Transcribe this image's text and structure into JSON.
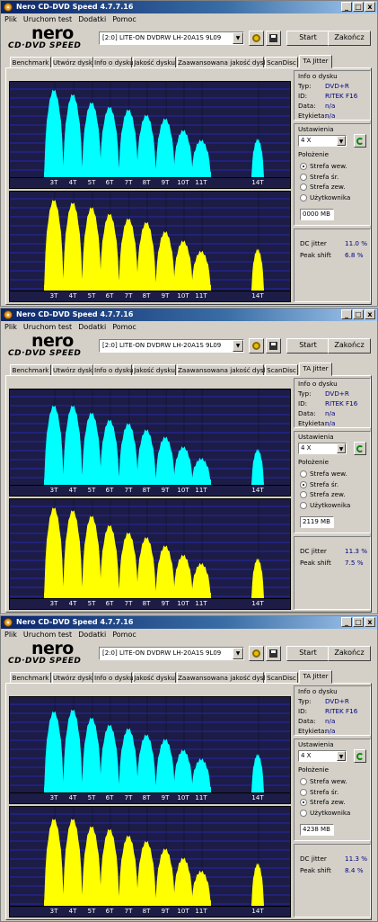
{
  "windows": [
    {
      "title": "Nero CD-DVD Speed 4.7.7.16",
      "title_buttons": [
        "_",
        "□",
        "x"
      ],
      "menu": [
        "Plik",
        "Uruchom test",
        "Dodatki",
        "Pomoc"
      ],
      "logo": {
        "brand": "nero",
        "sub": "CD·DVD SPEED"
      },
      "drive": "[2:0]   LITE-ON DVDRW LH-20A1S 9L09",
      "buttons": {
        "start": "Start",
        "close": "Zakończ"
      },
      "tabs": [
        "Benchmark",
        "Utwórz dysk",
        "Info o dysku",
        "Jakość dysku",
        "Zaawansowana jakość dysku",
        "ScanDisc",
        "TA Jitter"
      ],
      "active_tab": "TA Jitter",
      "x_ticks": [
        "3T",
        "4T",
        "5T",
        "6T",
        "7T",
        "8T",
        "9T",
        "10T",
        "11T",
        "14T"
      ],
      "disc_info": {
        "title": "Info o dysku",
        "rows": [
          {
            "label": "Typ:",
            "value": "DVD+R"
          },
          {
            "label": "ID:",
            "value": "RITEK F16"
          },
          {
            "label": "Data:",
            "value": "n/a"
          },
          {
            "label": "Etykieta:",
            "value": "n/a"
          }
        ]
      },
      "settings": {
        "title": "Ustawienia",
        "speed": "4 X"
      },
      "position": {
        "title": "Położenie",
        "options": [
          "Strefa wew.",
          "Strefa śr.",
          "Strefa zew.",
          "Użytkownika"
        ],
        "selected": 0,
        "mb": "0000 MB"
      },
      "stats": [
        {
          "label": "DC jitter",
          "value": "11.0 %"
        },
        {
          "label": "Peak shift",
          "value": "6.8 %"
        }
      ]
    },
    {
      "title": "Nero CD-DVD Speed 4.7.7.16",
      "title_buttons": [
        "_",
        "□",
        "x"
      ],
      "menu": [
        "Plik",
        "Uruchom test",
        "Dodatki",
        "Pomoc"
      ],
      "logo": {
        "brand": "nero",
        "sub": "CD·DVD SPEED"
      },
      "drive": "[2:0]   LITE-ON DVDRW LH-20A1S 9L09",
      "buttons": {
        "start": "Start",
        "close": "Zakończ"
      },
      "tabs": [
        "Benchmark",
        "Utwórz dysk",
        "Info o dysku",
        "Jakość dysku",
        "Zaawansowana jakość dysku",
        "ScanDisc",
        "TA Jitter"
      ],
      "active_tab": "TA Jitter",
      "x_ticks": [
        "3T",
        "4T",
        "5T",
        "6T",
        "7T",
        "8T",
        "9T",
        "10T",
        "11T",
        "14T"
      ],
      "disc_info": {
        "title": "Info o dysku",
        "rows": [
          {
            "label": "Typ:",
            "value": "DVD+R"
          },
          {
            "label": "ID:",
            "value": "RITEK F16"
          },
          {
            "label": "Data:",
            "value": "n/a"
          },
          {
            "label": "Etykieta:",
            "value": "n/a"
          }
        ]
      },
      "settings": {
        "title": "Ustawienia",
        "speed": "4 X"
      },
      "position": {
        "title": "Położenie",
        "options": [
          "Strefa wew.",
          "Strefa śr.",
          "Strefa zew.",
          "Użytkownika"
        ],
        "selected": 1,
        "mb": "2119 MB"
      },
      "stats": [
        {
          "label": "DC jitter",
          "value": "11.3 %"
        },
        {
          "label": "Peak shift",
          "value": "7.5 %"
        }
      ]
    },
    {
      "title": "Nero CD-DVD Speed 4.7.7.16",
      "title_buttons": [
        "_",
        "□",
        "x"
      ],
      "menu": [
        "Plik",
        "Uruchom test",
        "Dodatki",
        "Pomoc"
      ],
      "logo": {
        "brand": "nero",
        "sub": "CD·DVD SPEED"
      },
      "drive": "[2:0]   LITE-ON DVDRW LH-20A1S 9L09",
      "buttons": {
        "start": "Start",
        "close": "Zakończ"
      },
      "tabs": [
        "Benchmark",
        "Utwórz dysk",
        "Info o dysku",
        "Jakość dysku",
        "Zaawansowana jakość dysku",
        "ScanDisc",
        "TA Jitter"
      ],
      "active_tab": "TA Jitter",
      "x_ticks": [
        "3T",
        "4T",
        "5T",
        "6T",
        "7T",
        "8T",
        "9T",
        "10T",
        "11T",
        "14T"
      ],
      "disc_info": {
        "title": "Info o dysku",
        "rows": [
          {
            "label": "Typ:",
            "value": "DVD+R"
          },
          {
            "label": "ID:",
            "value": "RITEK F16"
          },
          {
            "label": "Data:",
            "value": "n/a"
          },
          {
            "label": "Etykieta:",
            "value": "n/a"
          }
        ]
      },
      "settings": {
        "title": "Ustawienia",
        "speed": "4 X"
      },
      "position": {
        "title": "Położenie",
        "options": [
          "Strefa wew.",
          "Strefa śr.",
          "Strefa zew.",
          "Użytkownika"
        ],
        "selected": 2,
        "mb": "4238 MB"
      },
      "stats": [
        {
          "label": "DC jitter",
          "value": "11.3 %"
        },
        {
          "label": "Peak shift",
          "value": "8.4 %"
        }
      ]
    }
  ],
  "colors": {
    "land": "#00ffff",
    "pit": "#ffff00",
    "chart_bg": "#1c1c46",
    "grid": "#2a2ad0"
  },
  "chart_data": [
    {
      "type": "area",
      "x": [
        "3T",
        "4T",
        "5T",
        "6T",
        "7T",
        "8T",
        "9T",
        "10T",
        "11T",
        "14T"
      ],
      "series": [
        {
          "values": [
            0.93,
            0.88,
            0.79,
            0.74,
            0.71,
            0.65,
            0.61,
            0.48,
            0.37,
            0.38
          ]
        },
        {
          "values": [
            0.93,
            0.9,
            0.85,
            0.78,
            0.73,
            0.69,
            0.59,
            0.49,
            0.38,
            0.4
          ]
        }
      ]
    },
    {
      "type": "area",
      "x": [
        "3T",
        "4T",
        "5T",
        "6T",
        "7T",
        "8T",
        "9T",
        "10T",
        "11T",
        "14T"
      ],
      "series": [
        {
          "values": [
            0.84,
            0.84,
            0.76,
            0.68,
            0.64,
            0.57,
            0.49,
            0.38,
            0.25,
            0.35
          ]
        },
        {
          "values": [
            0.93,
            0.9,
            0.84,
            0.74,
            0.66,
            0.61,
            0.52,
            0.42,
            0.33,
            0.38
          ]
        }
      ]
    },
    {
      "type": "area",
      "x": [
        "3T",
        "4T",
        "5T",
        "6T",
        "7T",
        "8T",
        "9T",
        "10T",
        "11T",
        "14T"
      ],
      "series": [
        {
          "values": [
            0.86,
            0.88,
            0.79,
            0.71,
            0.67,
            0.6,
            0.55,
            0.43,
            0.33,
            0.38
          ]
        },
        {
          "values": [
            0.89,
            0.89,
            0.81,
            0.78,
            0.71,
            0.65,
            0.57,
            0.47,
            0.33,
            0.41
          ]
        }
      ]
    }
  ]
}
